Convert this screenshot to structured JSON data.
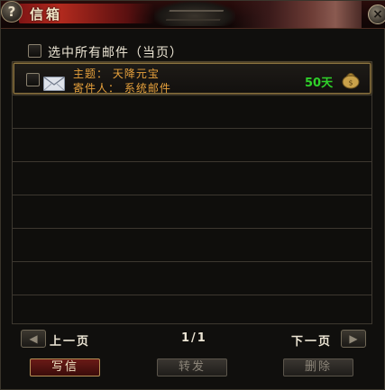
{
  "window": {
    "title": "信箱",
    "help_icon_label": "?",
    "close_icon_label": "×"
  },
  "select_all": {
    "label": "选中所有邮件（当页）",
    "checked": false
  },
  "mails": [
    {
      "subject": "主题： 天降元宝",
      "sender": "寄件人： 系统邮件",
      "days_left": "50天",
      "checked": false,
      "icon": "envelope-icon",
      "attachment_icon": "moneybag-icon"
    }
  ],
  "pager": {
    "prev_label": "上一页",
    "next_label": "下一页",
    "page_indicator": "1/1"
  },
  "buttons": {
    "write": "写信",
    "forward": "转发",
    "delete": "删除"
  },
  "colors": {
    "mail_text": "#e7a13c",
    "days_text": "#2fd02a",
    "primary_text": "#ece5d4"
  }
}
